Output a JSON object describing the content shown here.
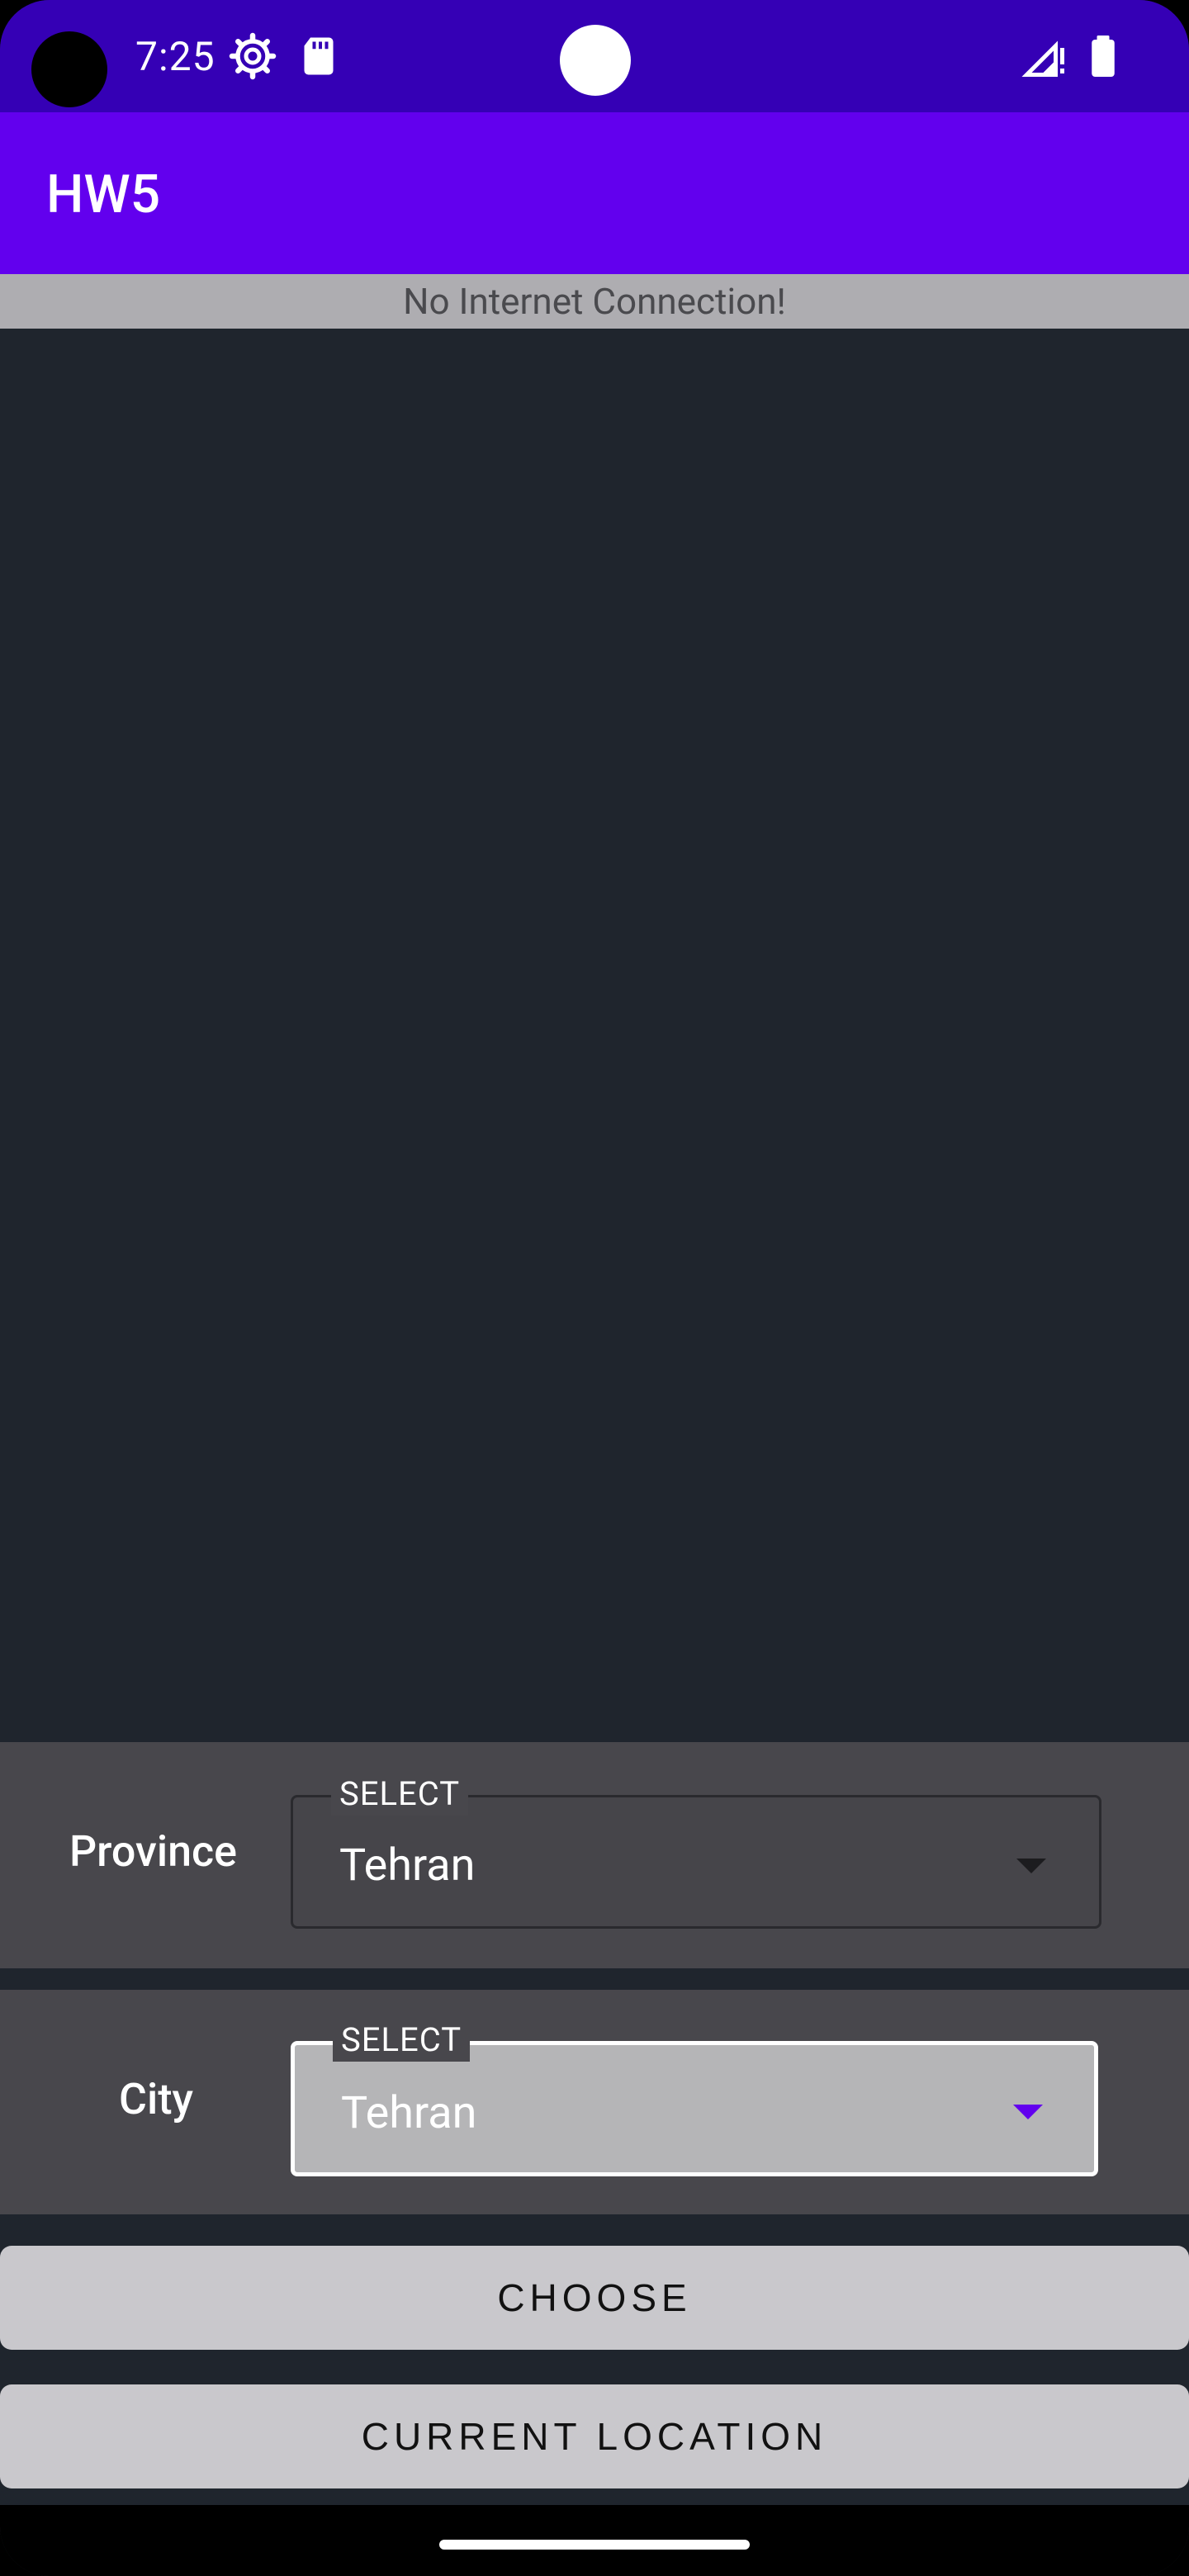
{
  "status_bar": {
    "time": "7:25",
    "icons": [
      "settings-gear-icon",
      "sd-card-icon",
      "signal-no-data-icon",
      "battery-icon"
    ]
  },
  "app_bar": {
    "title": "HW5"
  },
  "banner": {
    "text": "No Internet Connection!"
  },
  "province": {
    "label": "Province",
    "caption": "SELECT",
    "value": "Tehran"
  },
  "city": {
    "label": "City",
    "caption": "SELECT",
    "value": "Tehran"
  },
  "buttons": {
    "choose": "CHOOSE",
    "current_location": "CURRENT LOCATION"
  },
  "colors": {
    "status_bar": "#3500b5",
    "app_bar": "#6200ee",
    "accent": "#6200ee",
    "banner": "#aeadb1",
    "background": "#1f252d"
  }
}
